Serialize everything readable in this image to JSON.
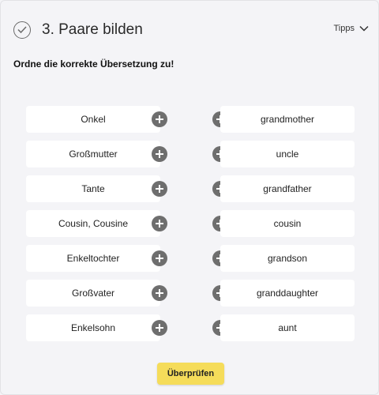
{
  "header": {
    "title": "3. Paare bilden",
    "tips_label": "Tipps"
  },
  "instruction": "Ordne die korrekte Übersetzung zu!",
  "left_items": [
    "Onkel",
    "Großmutter",
    "Tante",
    "Cousin, Cousine",
    "Enkeltochter",
    "Großvater",
    "Enkelsohn"
  ],
  "right_items": [
    "grandmother",
    "uncle",
    "grandfather",
    "cousin",
    "grandson",
    "granddaughter",
    "aunt"
  ],
  "check_button_label": "Überprüfen",
  "icons": {
    "header": "check-circle-icon",
    "tips": "chevron-down-icon",
    "add": "plus-circle-icon"
  },
  "colors": {
    "accent_button": "#f5dc5a",
    "plus_icon": "#6e6e6e",
    "tile": "#ffffff",
    "background": "#f4f4f7"
  }
}
